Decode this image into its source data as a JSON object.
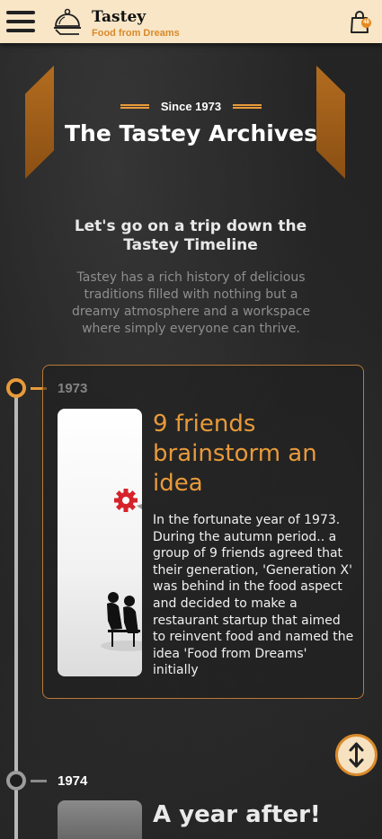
{
  "header": {
    "brand_name": "Tastey",
    "brand_tagline": "Food from Dreams",
    "cart_count": "48"
  },
  "hero": {
    "since_label": "Since 1973",
    "title": "The Tastey Archives"
  },
  "intro": {
    "heading": "Let's go on a trip down the Tastey Timeline",
    "text": "Tastey has a rich history of delicious traditions filled with nothing but a dreamy atmosphere and a workspace where simply everyone can thrive."
  },
  "timeline": [
    {
      "year": "1973",
      "title": "9 friends brainstorm an idea",
      "body": "In the fortunate year of 1973. During the autumn period.. a group of 9 friends agreed that their generation, 'Generation X' was behind in the food aspect and decided to make a restaurant startup that aimed to reinvent food and named the idea 'Food from Dreams' initially"
    },
    {
      "year": "1974",
      "title": "A year after!"
    }
  ],
  "colors": {
    "accent": "#e89a3a",
    "header_bg": "#f8e6c6",
    "dark_bg": "#1c1c1c"
  },
  "icons": [
    "menu-icon",
    "cloche-icon",
    "shopping-bag-icon",
    "vertical-arrows-icon"
  ]
}
